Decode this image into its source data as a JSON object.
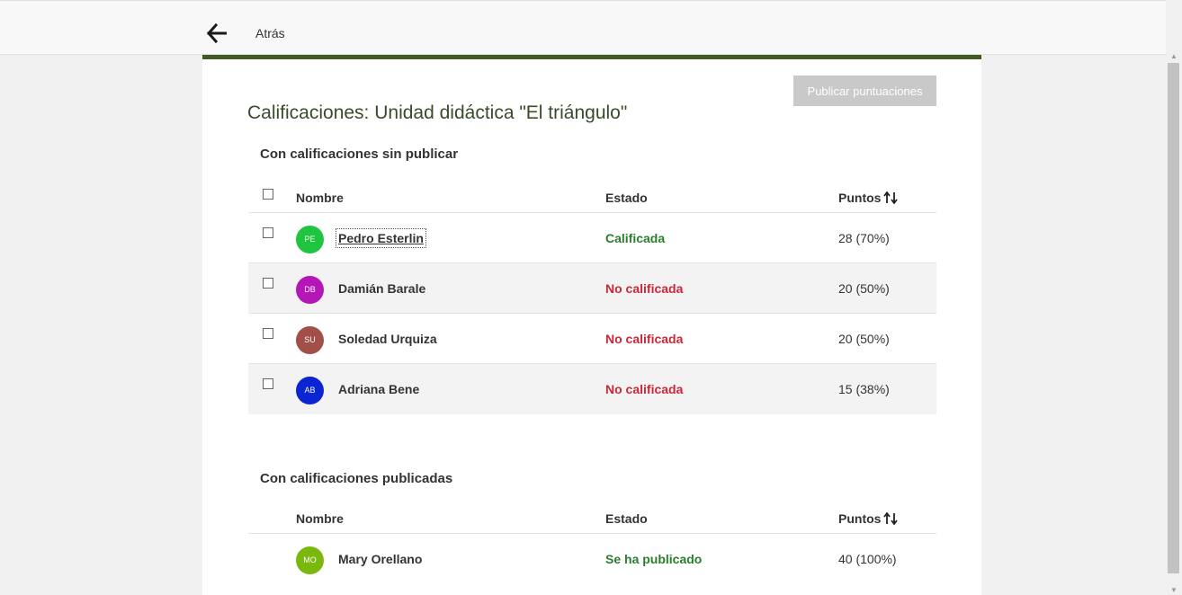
{
  "header": {
    "back_label": "Atrás"
  },
  "page": {
    "title": "Calificaciones: Unidad didáctica \"El triángulo\"",
    "publish_button": "Publicar puntuaciones"
  },
  "unpublished": {
    "title": "Con calificaciones sin publicar",
    "columns": {
      "name": "Nombre",
      "state": "Estado",
      "points": "Puntos"
    },
    "rows": [
      {
        "initials": "PE",
        "name": "Pedro Esterlin",
        "state": "Calificada",
        "points": "28 (70%)",
        "avatar_color": "#1fc43f",
        "state_color": "#2a7d2e"
      },
      {
        "initials": "DB",
        "name": "Damián Barale",
        "state": "No calificada",
        "points": "20 (50%)",
        "avatar_color": "#b416b8",
        "state_color": "#c8283a"
      },
      {
        "initials": "SU",
        "name": "Soledad Urquiza",
        "state": "No calificada",
        "points": "20 (50%)",
        "avatar_color": "#a14f48",
        "state_color": "#c8283a"
      },
      {
        "initials": "AB",
        "name": "Adriana Bene",
        "state": "No calificada",
        "points": "15 (38%)",
        "avatar_color": "#0a25d1",
        "state_color": "#c8283a"
      }
    ]
  },
  "published": {
    "title": "Con calificaciones publicadas",
    "columns": {
      "name": "Nombre",
      "state": "Estado",
      "points": "Puntos"
    },
    "rows": [
      {
        "initials": "MO",
        "name": "Mary Orellano",
        "state": "Se ha publicado",
        "points": "40 (100%)",
        "avatar_color": "#7ab80e",
        "state_color": "#2a7d2e"
      }
    ]
  },
  "colors": {
    "accent": "#3f5b24",
    "published_green": "#2a7d2e",
    "unpublished_red": "#c8283a"
  },
  "icons": {
    "back": "arrow-left-icon",
    "sort": "sort-arrows-icon"
  }
}
